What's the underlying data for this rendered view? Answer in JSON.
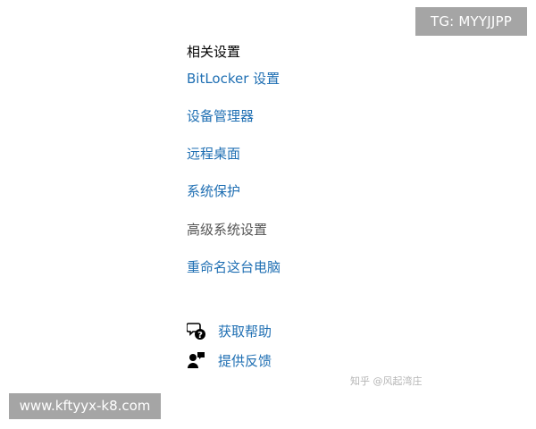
{
  "overlay": {
    "tg_label": "TG: MYYJJPP",
    "site_url": "www.kftyyx-k8.com"
  },
  "related_settings": {
    "title": "相关设置",
    "links": [
      {
        "label": "BitLocker 设置",
        "enabled": true
      },
      {
        "label": "设备管理器",
        "enabled": true
      },
      {
        "label": "远程桌面",
        "enabled": true
      },
      {
        "label": "系统保护",
        "enabled": true
      },
      {
        "label": "高级系统设置",
        "enabled": false
      },
      {
        "label": "重命名这台电脑",
        "enabled": true
      }
    ]
  },
  "support": {
    "help": {
      "label": "获取帮助",
      "icon": "help-chat-icon"
    },
    "feedback": {
      "label": "提供反馈",
      "icon": "feedback-person-icon"
    }
  },
  "watermark": {
    "text": "知乎 @风起湾庄"
  },
  "colors": {
    "link": "#1f6fb3",
    "muted_link": "#555555",
    "overlay_bg": "#a5a5a5"
  }
}
